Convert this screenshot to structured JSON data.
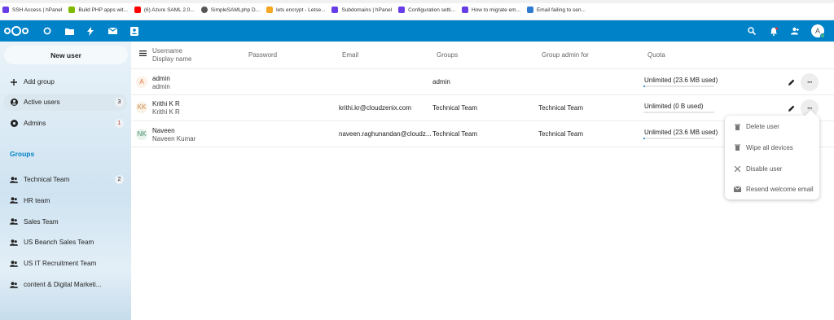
{
  "bookmarks": [
    {
      "label": "SSH Access | hPanel",
      "icon": "hpanel-icon",
      "color": "#673de6"
    },
    {
      "label": "Build PHP apps wit...",
      "icon": "microsoft-icon",
      "color": "#7fba00"
    },
    {
      "label": "(6) Azure SAML 2.0...",
      "icon": "youtube-icon",
      "color": "#ff0000"
    },
    {
      "label": "SimpleSAMLphp D...",
      "icon": "globe-icon",
      "color": "#555555"
    },
    {
      "label": "lets encrypt - Letse...",
      "icon": "lightbulb-icon",
      "color": "#f5a623"
    },
    {
      "label": "Subdomains | hPanel",
      "icon": "hpanel-icon",
      "color": "#673de6"
    },
    {
      "label": "Configuration setti...",
      "icon": "hpanel-icon",
      "color": "#673de6"
    },
    {
      "label": "How to migrate em...",
      "icon": "hpanel-icon",
      "color": "#673de6"
    },
    {
      "label": "Email failing to sen...",
      "icon": "mail-app-icon",
      "color": "#2e7bcf"
    }
  ],
  "header": {
    "brand_color": "#0082c9",
    "apps": [
      "dashboard-icon",
      "files-icon",
      "activity-icon",
      "mail-icon",
      "contacts-icon"
    ],
    "right_icons": [
      "search-icon",
      "notifications-icon",
      "contacts-menu-icon"
    ],
    "avatar_letter": "A"
  },
  "sidebar": {
    "new_user": "New user",
    "add_group": "Add group",
    "active_users": {
      "label": "Active users",
      "count": "3"
    },
    "admins": {
      "label": "Admins",
      "count": "1"
    },
    "groups_heading": "Groups",
    "groups": [
      {
        "label": "Technical Team",
        "count": "2"
      },
      {
        "label": "HR team",
        "count": ""
      },
      {
        "label": "Sales Team",
        "count": ""
      },
      {
        "label": "US Beanch Sales Team",
        "count": ""
      },
      {
        "label": "US IT Recruitment Team",
        "count": ""
      },
      {
        "label": "content & Digital Marketi...",
        "count": ""
      }
    ]
  },
  "table": {
    "headers": {
      "username": "Username",
      "display_name": "Display name",
      "password": "Password",
      "email": "Email",
      "groups": "Groups",
      "group_admin": "Group admin for",
      "quota": "Quota"
    },
    "rows": [
      {
        "initials": "A",
        "initials_color": "#e07a3a",
        "avatar_bg": "#fdf1ea",
        "username": "admin",
        "display_name": "admin",
        "email": "",
        "groups": "admin",
        "group_admin": "",
        "quota": "Unlimited (23.6 MB used)",
        "quota_fill": 0.02
      },
      {
        "initials": "KK",
        "initials_color": "#c9894a",
        "avatar_bg": "#fbf2e6",
        "username": "Krithi K R",
        "display_name": "Krithi K R",
        "email": "krithi.kr@cloudzenix.com",
        "groups": "Technical Team",
        "group_admin": "Technical Team",
        "quota": "Unlimited (0 B used)",
        "quota_fill": 0
      },
      {
        "initials": "NK",
        "initials_color": "#4a8f6a",
        "avatar_bg": "#e8f3ec",
        "username": "Naveen",
        "display_name": "Naveen Kumar",
        "email": "naveen.raghunandan@cloudz...",
        "groups": "Technical Team",
        "group_admin": "Technical Team",
        "quota": "Unlimited (23.6 MB used)",
        "quota_fill": 0.02
      }
    ]
  },
  "actions_menu": [
    {
      "label": "Delete user",
      "icon": "trash-icon"
    },
    {
      "label": "Wipe all devices",
      "icon": "trash-icon"
    },
    {
      "label": "Disable user",
      "icon": "close-icon"
    },
    {
      "label": "Resend welcome email",
      "icon": "mail-icon"
    }
  ]
}
